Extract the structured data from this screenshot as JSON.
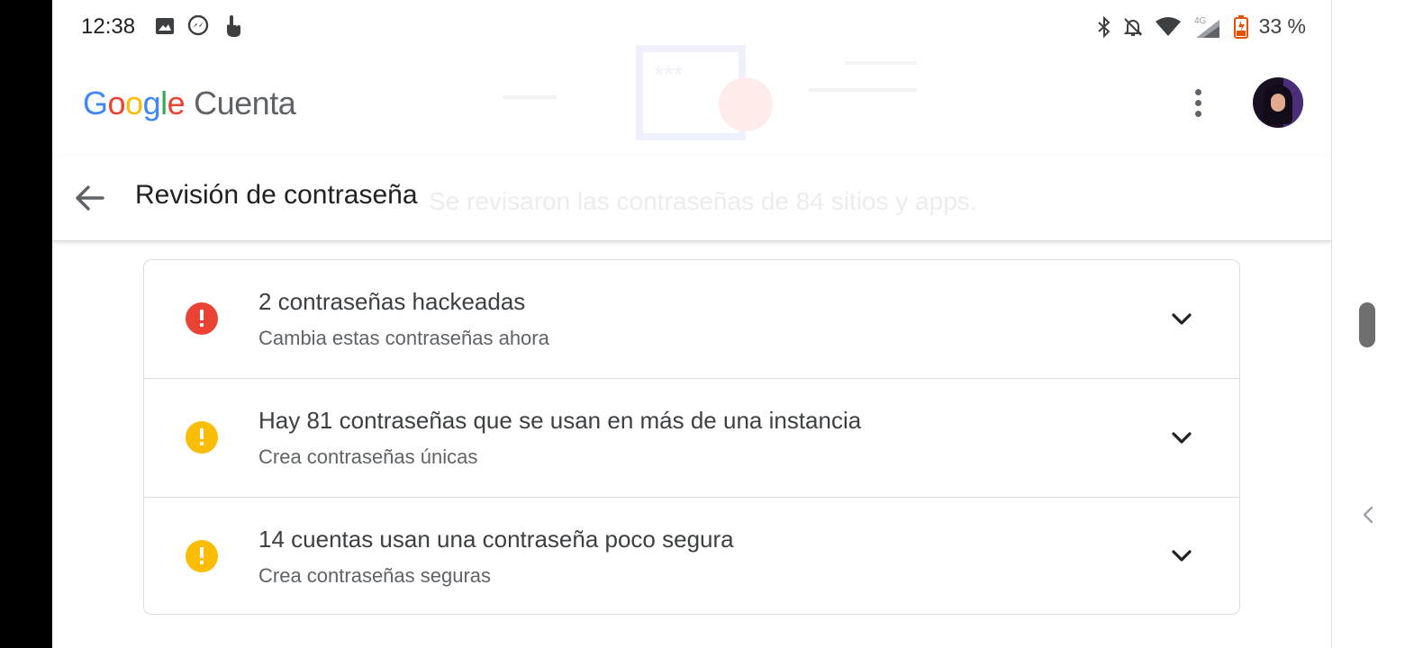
{
  "status_bar": {
    "time": "12:38",
    "left_icons": [
      "image-icon",
      "messenger-icon",
      "touch-icon"
    ],
    "right_icons": [
      "bluetooth-icon",
      "bell-off-icon",
      "wifi-icon",
      "signal-4g-icon",
      "battery-icon"
    ],
    "network_type": "4G",
    "battery_percent": "33 %"
  },
  "header": {
    "logo": "Google",
    "product": "Cuenta"
  },
  "subheader": {
    "title": "Revisión de contraseña"
  },
  "background_ghost_text": "Se revisaron las contraseñas de 84 sitios y apps.",
  "issues": [
    {
      "title": "2 contraseñas hackeadas",
      "subtitle": "Cambia estas contraseñas ahora",
      "severity": "critical",
      "icon": "error-icon",
      "color": "#EA4335"
    },
    {
      "title": "Hay 81 contraseñas que se usan en más de una instancia",
      "subtitle": "Crea contraseñas únicas",
      "severity": "warning",
      "icon": "warning-icon",
      "color": "#FBBC04"
    },
    {
      "title": "14 cuentas usan una contraseña poco segura",
      "subtitle": "Crea contraseñas seguras",
      "severity": "warning",
      "icon": "warning-icon",
      "color": "#FBBC04"
    }
  ],
  "colors": {
    "error": "#EA4335",
    "warning": "#FBBC04",
    "text_primary": "#202124",
    "text_secondary": "#5f6368",
    "divider": "#dadce0"
  }
}
